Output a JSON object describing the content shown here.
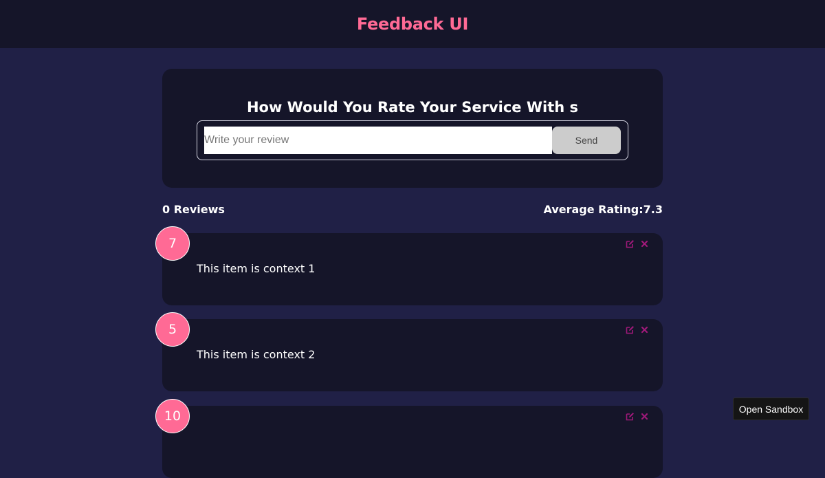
{
  "header": {
    "title": "Feedback UI"
  },
  "review_form": {
    "heading": "How Would You Rate Your Service With s",
    "input_placeholder": "Write your review",
    "send_label": "Send"
  },
  "stats": {
    "count_label": "0 Reviews",
    "average_label": "Average Rating:7.3"
  },
  "feedback_items": [
    {
      "rating": "7",
      "text": "This item is context 1"
    },
    {
      "rating": "5",
      "text": "This item is context 2"
    },
    {
      "rating": "10",
      "text": ""
    }
  ],
  "icons": {
    "edit": "edit-icon",
    "delete": "close-icon"
  },
  "colors": {
    "accent": "#ff6a95",
    "page_bg": "#202046",
    "card_bg": "#151529",
    "icon": "#a0197a"
  },
  "sandbox": {
    "label": "Open Sandbox"
  }
}
